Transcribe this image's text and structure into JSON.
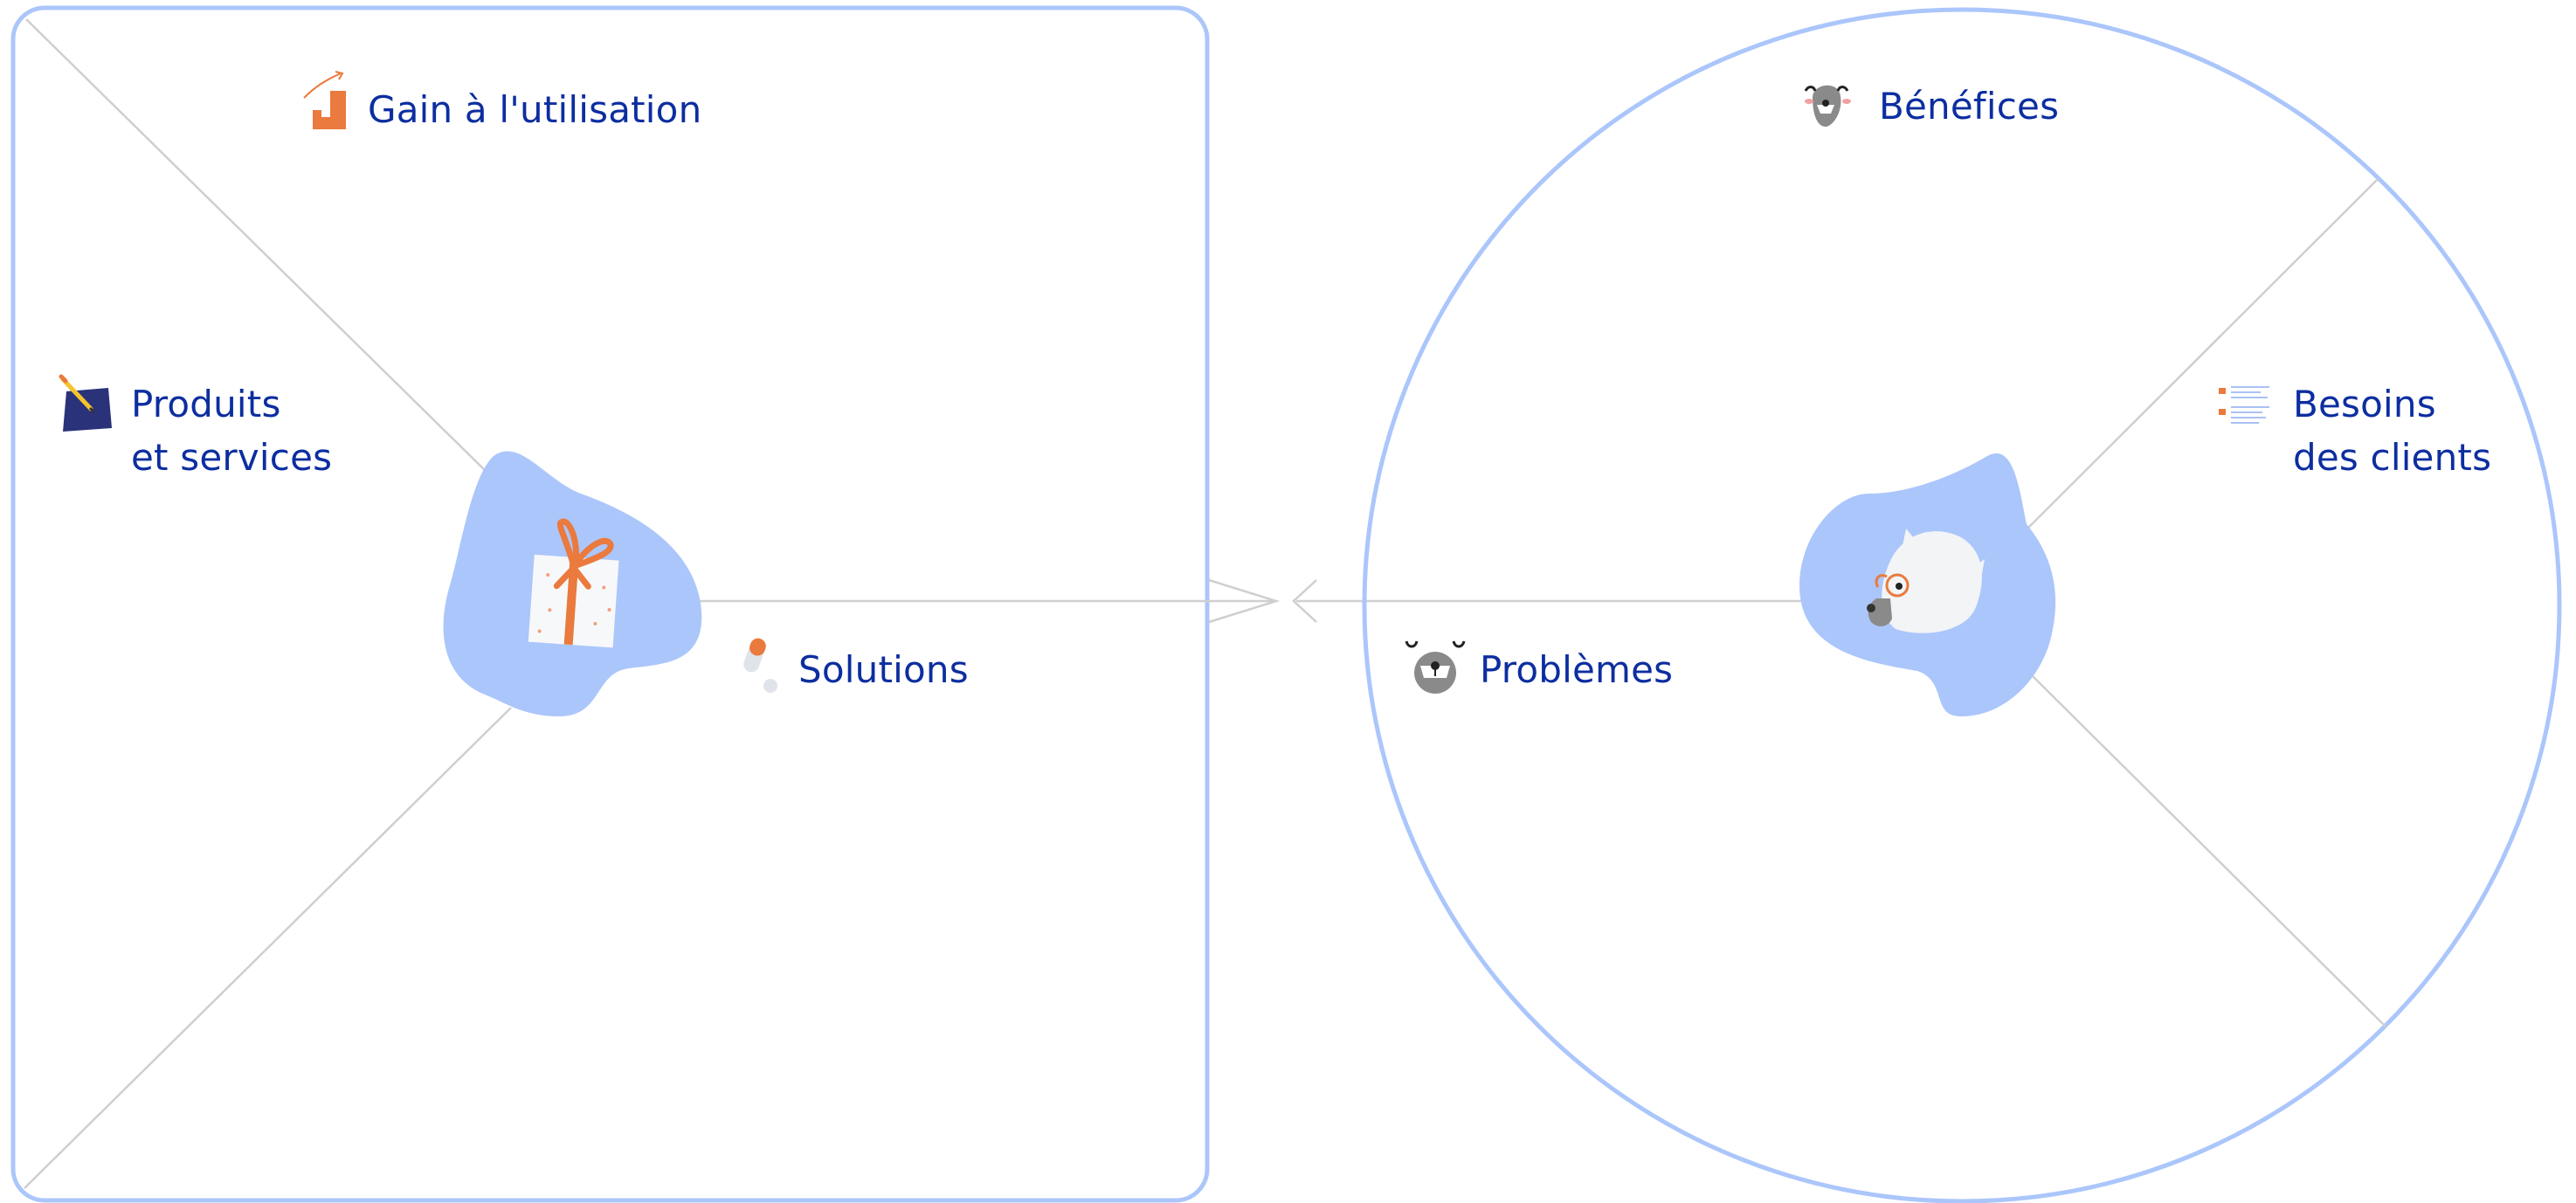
{
  "labels": {
    "gain": "Gain à l'utilisation",
    "products_line1": "Produits",
    "products_line2": "et services",
    "solutions": "Solutions",
    "benefits": "Bénéfices",
    "needs_line1": "Besoins",
    "needs_line2": "des clients",
    "problems": "Problèmes"
  },
  "icons": {
    "gain": "growth-bar-chart-icon",
    "products": "pencil-notebook-icon",
    "solutions": "pill-icon",
    "benefits": "smiling-bear-face-icon",
    "needs": "checklist-icon",
    "problems": "grumpy-bear-face-icon",
    "product_center": "gift-box-icon",
    "customer_center": "customer-bear-glasses-icon"
  },
  "colors": {
    "outline": "#abc6fb",
    "blob": "#abc6fb",
    "label_text": "#0d2ea0",
    "accent": "#ea7a3d",
    "divider": "#cfcfcf"
  }
}
